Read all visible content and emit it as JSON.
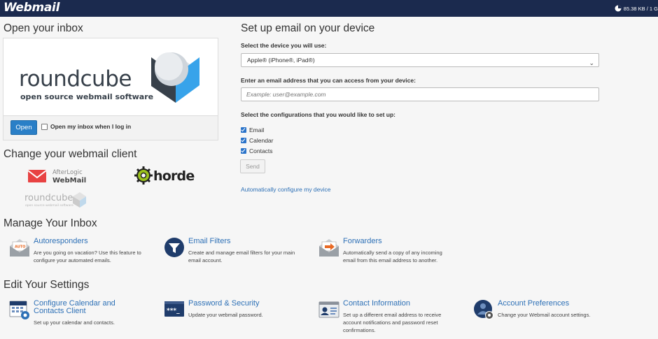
{
  "header": {
    "brand": "Webmail",
    "quota": "85.38 KB / 1 G"
  },
  "inbox": {
    "heading": "Open your inbox",
    "logo_wordmark": "roundcube",
    "logo_tagline": "open source webmail software",
    "open_button": "Open",
    "auto_open_label": "Open my inbox when I log in"
  },
  "clients": {
    "heading": "Change your webmail client",
    "afterlogic_top": "AfterLogic",
    "afterlogic_bottom": "WebMail",
    "horde": "horde",
    "roundcube": "roundcube",
    "roundcube_tag": "open source webmail software"
  },
  "setup": {
    "heading": "Set up email on your device",
    "device_label": "Select the device you will use:",
    "device_value": "Apple® (iPhone®, iPad®)",
    "email_label": "Enter an email address that you can access from your device:",
    "email_placeholder": "Example: user@example.com",
    "config_label": "Select the configurations that you would like to set up:",
    "configs": [
      {
        "label": "Email",
        "checked": true
      },
      {
        "label": "Calendar",
        "checked": true
      },
      {
        "label": "Contacts",
        "checked": true
      }
    ],
    "send_button": "Send",
    "auto_config_link": "Automatically configure my device"
  },
  "manage": {
    "heading": "Manage Your Inbox",
    "items": [
      {
        "title": "Autoresponders",
        "icon": "autoresponder-icon",
        "desc": [
          "Are you going on vacation? Use this feature to",
          "configure your automated emails."
        ]
      },
      {
        "title": "Email Filters",
        "icon": "filter-funnel-icon",
        "desc": [
          "Create and manage email filters for your main",
          "email account."
        ]
      },
      {
        "title": "Forwarders",
        "icon": "forwarder-envelope-icon",
        "desc": [
          "Automatically send a copy of any incoming",
          "email from this email address to another."
        ]
      }
    ]
  },
  "settings": {
    "heading": "Edit Your Settings",
    "items": [
      {
        "title": [
          "Configure Calendar and",
          "Contacts Client"
        ],
        "icon": "calendar-icon",
        "desc": [
          "Set up your calendar and contacts."
        ]
      },
      {
        "title": [
          "Password & Security"
        ],
        "icon": "password-icon",
        "desc": [
          "Update your webmail password."
        ]
      },
      {
        "title": [
          "Contact Information"
        ],
        "icon": "contact-card-icon",
        "desc": [
          "Set up a different email address to receive",
          "account notifications and password reset",
          "confirmations."
        ]
      },
      {
        "title": [
          "Account Preferences"
        ],
        "icon": "account-preferences-icon",
        "desc": [
          "Change your Webmail account settings."
        ]
      }
    ]
  },
  "colors": {
    "topbar": "#1b2a4e",
    "link": "#2d70b6",
    "primary_button": "#2a7fc7",
    "checkbox": "#2a73c9"
  }
}
